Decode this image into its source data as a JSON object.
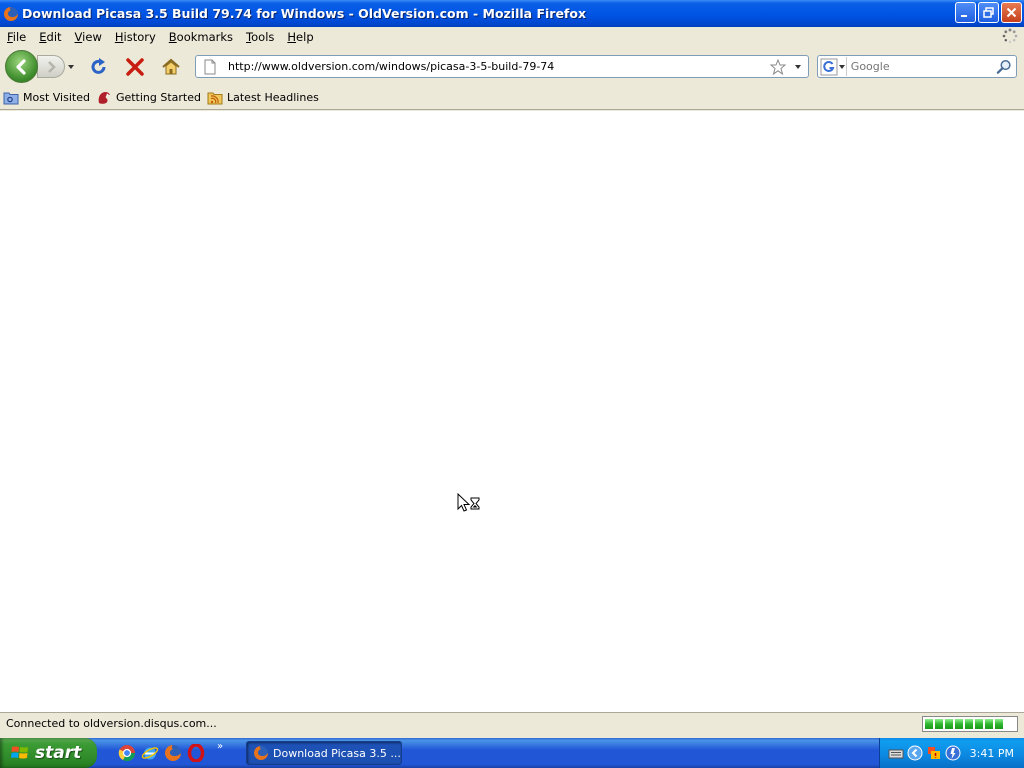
{
  "window": {
    "title": "Download Picasa 3.5 Build 79.74 for Windows - OldVersion.com - Mozilla Firefox"
  },
  "menu": {
    "items": [
      {
        "label": "File",
        "accel": "F",
        "rest": "ile"
      },
      {
        "label": "Edit",
        "accel": "E",
        "rest": "dit"
      },
      {
        "label": "View",
        "accel": "V",
        "rest": "iew"
      },
      {
        "label": "History",
        "accel": "H",
        "rest": "istory"
      },
      {
        "label": "Bookmarks",
        "accel": "B",
        "rest": "ookmarks"
      },
      {
        "label": "Tools",
        "accel": "T",
        "rest": "ools"
      },
      {
        "label": "Help",
        "accel": "H",
        "rest": "elp"
      }
    ]
  },
  "navbar": {
    "url": "http://www.oldversion.com/windows/picasa-3-5-build-79-74",
    "search_placeholder": "Google"
  },
  "bookmarks": {
    "items": [
      "Most Visited",
      "Getting Started",
      "Latest Headlines"
    ]
  },
  "status": {
    "text": "Connected to oldversion.disqus.com...",
    "progress_segments": 8
  },
  "taskbar": {
    "start_label": "start",
    "task_label": "Download Picasa 3.5 ...",
    "more_indicator": "»",
    "clock": "3:41 PM"
  },
  "colors": {
    "titlebar": "#0055e5",
    "taskbar": "#2157d7",
    "start": "#3c9b35",
    "chrome": "#ece9d8"
  }
}
